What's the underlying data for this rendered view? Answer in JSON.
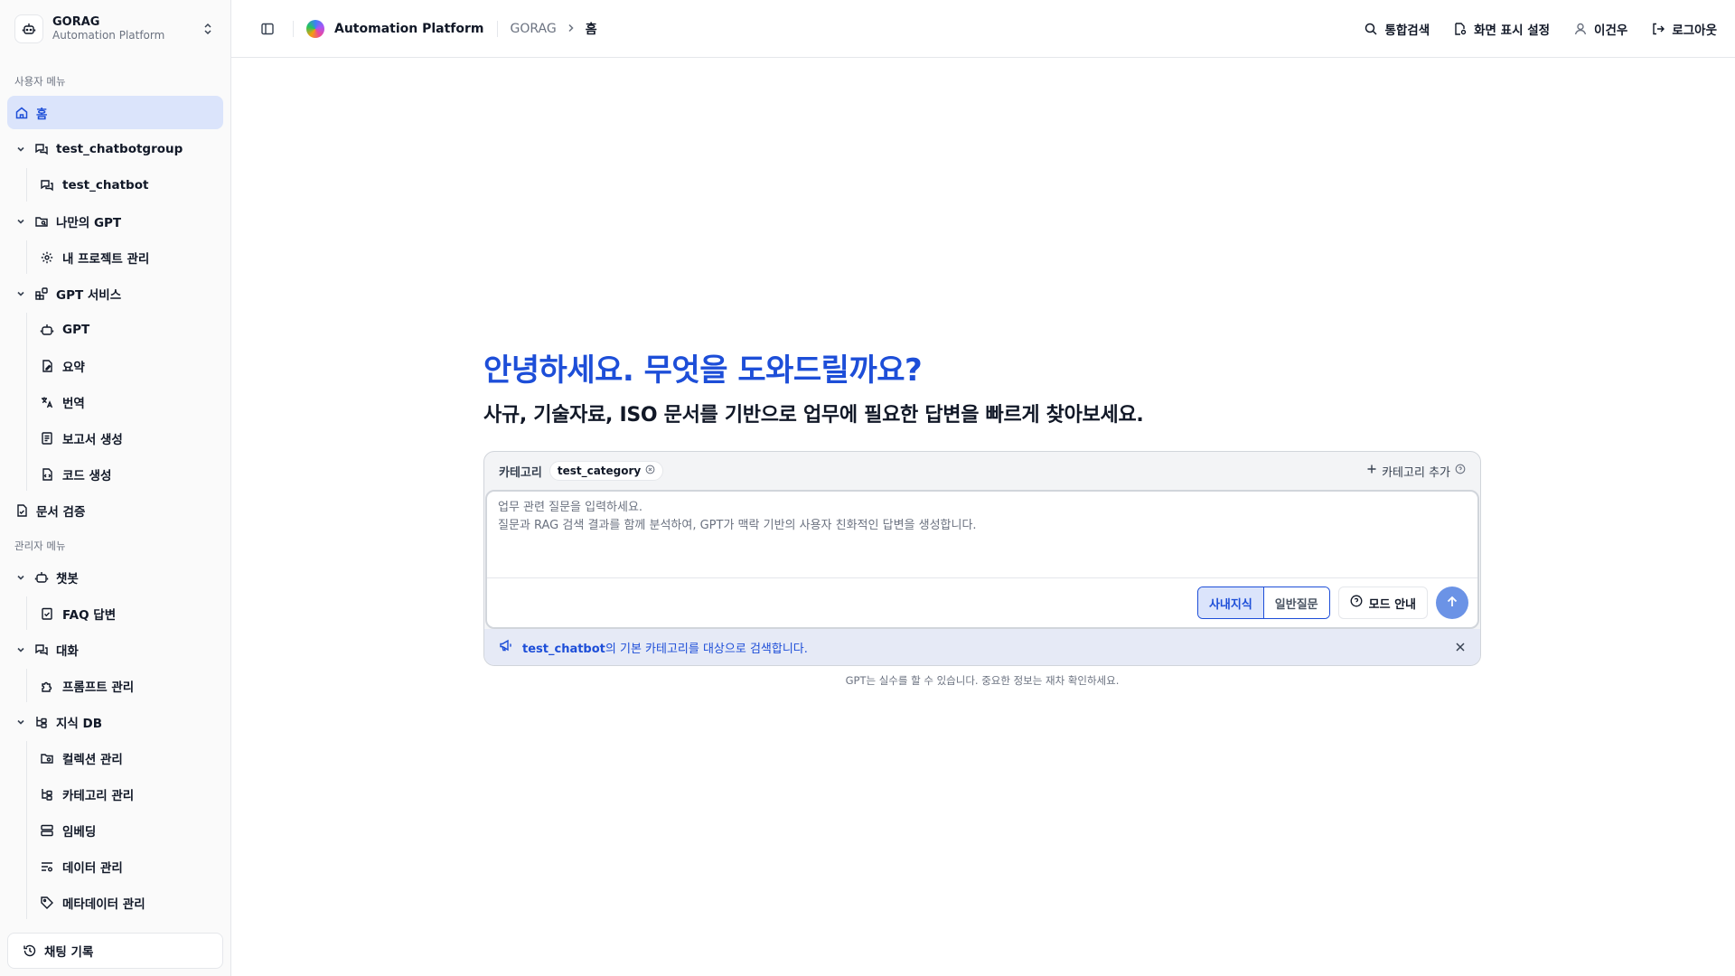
{
  "brand": {
    "name": "GORAG",
    "subtitle": "Automation Platform"
  },
  "sidebar": {
    "user_section": "사용자 메뉴",
    "admin_section": "관리자 메뉴",
    "home": "홈",
    "groups": {
      "chatbotgroup": {
        "label": "test_chatbotgroup",
        "items": [
          "test_chatbot"
        ]
      },
      "mygpt": {
        "label": "나만의 GPT",
        "items": [
          "내 프로젝트 관리"
        ]
      },
      "gptservice": {
        "label": "GPT 서비스",
        "items": [
          "GPT",
          "요약",
          "번역",
          "보고서 생성",
          "코드 생성"
        ]
      },
      "docverify": {
        "label": "문서 검증"
      },
      "chatbot": {
        "label": "챗봇",
        "items": [
          "FAQ 답변"
        ]
      },
      "conversation": {
        "label": "대화",
        "items": [
          "프롬프트 관리"
        ]
      },
      "knowledge": {
        "label": "지식 DB",
        "items": [
          "컬렉션 관리",
          "카테고리 관리",
          "임베딩",
          "데이터 관리",
          "메타데이터 관리"
        ]
      }
    },
    "history_button": "채팅 기록"
  },
  "topbar": {
    "app_title": "Automation Platform",
    "breadcrumb": [
      "GORAG",
      "홈"
    ],
    "actions": {
      "search": "통합검색",
      "display": "화면 표시 설정",
      "user": "이건우",
      "logout": "로그아웃"
    }
  },
  "hero": {
    "title": "안녕하세요. 무엇을 도와드릴까요?",
    "subtitle": "사규, 기술자료, ISO 문서를 기반으로 업무에 필요한 답변을 빠르게 찾아보세요."
  },
  "composer": {
    "category_label": "카테고리",
    "category_chip": "test_category",
    "add_category": "카테고리 추가",
    "placeholder_line1": "업무 관련 질문을 입력하세요.",
    "placeholder_line2": "질문과 RAG 검색 결과를 함께 분석하여, GPT가 맥락 기반의 사용자 친화적인 답변을 생성합니다.",
    "mode_internal": "사내지식",
    "mode_general": "일반질문",
    "mode_guide": "모드 안내",
    "notice_bold": "test_chatbot",
    "notice_rest": "의 기본 카테고리를 대상으로 검색합니다.",
    "disclaimer": "GPT는 실수를 할 수 있습니다. 중요한 정보는 재차 확인하세요."
  },
  "colors": {
    "accent": "#1d4ed8",
    "active_bg": "#dbe4fb",
    "send": "#6b93e6"
  }
}
